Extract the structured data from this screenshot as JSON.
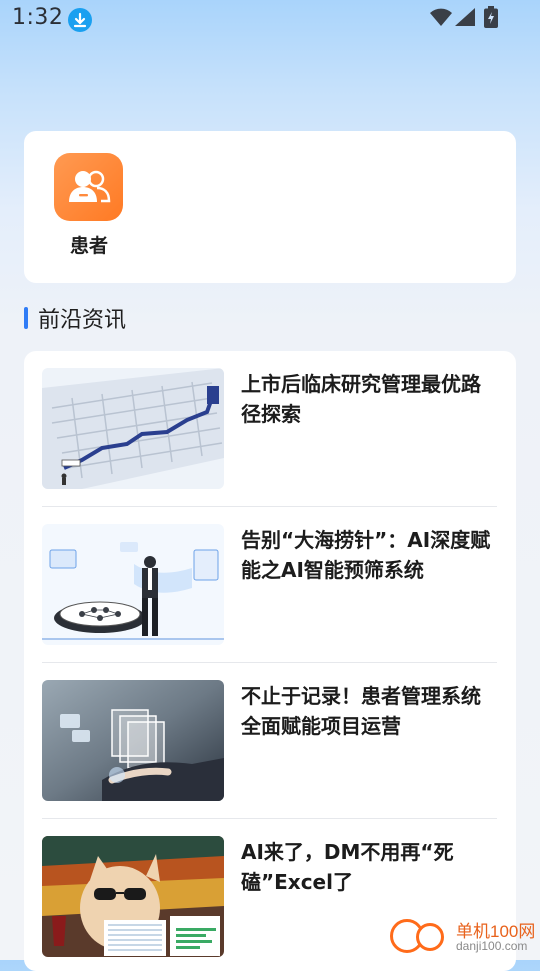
{
  "status_bar": {
    "time": "1:32",
    "icons": [
      "download-icon",
      "wifi-icon",
      "signal-icon",
      "battery-icon"
    ]
  },
  "quick_access": {
    "items": [
      {
        "label": "患者",
        "icon": "patient-icon",
        "color": "#ff8a3d"
      }
    ]
  },
  "section": {
    "title": "前沿资讯",
    "accent_color": "#2f7cf6"
  },
  "news": [
    {
      "title": "上市后临床研究管理最优路径探索",
      "image": "maze-illustration"
    },
    {
      "title": "告别“大海捞针”：AI深度赋能之AI智能预筛系统",
      "image": "businessman-data-illustration"
    },
    {
      "title": "不止于记录！患者管理系统全面赋能项目运营",
      "image": "hand-documents-illustration"
    },
    {
      "title": "AI来了，DM不用再“死磕”Excel了",
      "image": "cat-sunglasses-spreadsheet"
    }
  ],
  "watermark": {
    "line1": "单机100网",
    "line2": "danji100.com"
  }
}
